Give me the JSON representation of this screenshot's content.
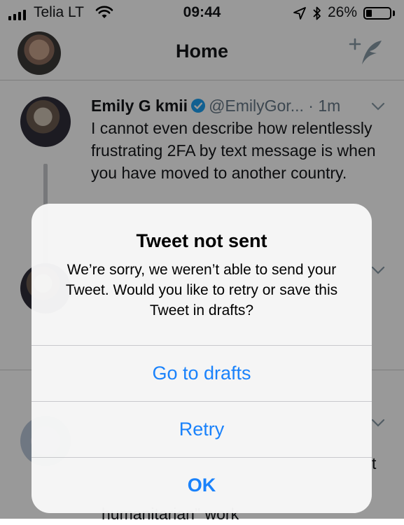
{
  "status_bar": {
    "carrier": "Telia LT",
    "time": "09:44",
    "battery_percent": "26%",
    "battery_level": 0.26,
    "icons": [
      "signal-icon",
      "wifi-icon",
      "location-arrow-icon",
      "bluetooth-icon",
      "battery-icon"
    ]
  },
  "nav": {
    "title": "Home",
    "icons": [
      "profile-avatar",
      "compose-tweet-icon"
    ]
  },
  "timeline": {
    "tweet1": {
      "name": "Emily G kmii",
      "handle": "@EmilyGor...",
      "separator": "·",
      "time": "1m",
      "text": "I cannot even describe how relentlessly frustrating 2FA by text message is when you have moved to another country."
    },
    "tweet3": {
      "partial_text_right": "t",
      "partial_text_bottom": "humanitarian\" work"
    }
  },
  "alert": {
    "title": "Tweet not sent",
    "message": "We’re sorry, we weren’t able to send your Tweet. Would you like to retry or save this Tweet in drafts?",
    "buttons": {
      "drafts": "Go to drafts",
      "retry": "Retry",
      "ok": "OK"
    },
    "button_color": "#1a82fb"
  },
  "colors": {
    "verified_badge": "#1da1f2",
    "handle_gray": "#657786",
    "compose_icon": "#8899a6"
  }
}
